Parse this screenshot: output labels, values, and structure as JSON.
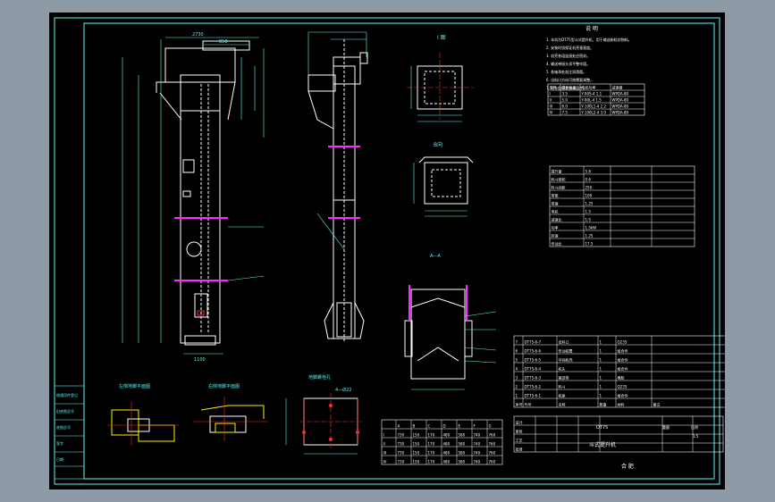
{
  "colors": {
    "background": "#000000",
    "frame": "#5FF3F3",
    "geometry": "#FFFFFF",
    "dimension": "#5FF3F3",
    "accent_magenta": "#FF2BFF",
    "accent_red": "#FF2A2A",
    "accent_yellow": "#FFF200",
    "outer_grey": "#8E9AA6"
  },
  "labels": {
    "view_top": "I 图",
    "view_side": "B向",
    "section": "A—A",
    "hole_label": "4—Ø22",
    "base_label": "地脚螺栓孔",
    "left_plan": "左侧地脚平面图",
    "right_plan": "右侧地脚平面图",
    "notes_heading": "说 明",
    "ratio_label": "1:5",
    "dims": {
      "d2730": "2730",
      "d850": "850",
      "d580": "580",
      "d1100": "1100",
      "d500": "500",
      "d400": "400",
      "d200": "200",
      "d600": "600"
    }
  },
  "bom_rows": [
    {
      "no": "7",
      "code": "DT75-6-7",
      "name": "出料口",
      "qty": "1",
      "mat": "Q235"
    },
    {
      "no": "6",
      "code": "DT75-6-6",
      "name": "传动装置",
      "qty": "1",
      "mat": "组合件"
    },
    {
      "no": "5",
      "code": "DT75-6-5",
      "name": "中间机壳",
      "qty": "1",
      "mat": "组合件"
    },
    {
      "no": "4",
      "code": "DT75-6-4",
      "name": "机头",
      "qty": "1",
      "mat": "组合件"
    },
    {
      "no": "3",
      "code": "DT75-6-3",
      "name": "输送带",
      "qty": "1",
      "mat": "橡胶"
    },
    {
      "no": "2",
      "code": "DT75-6-2",
      "name": "料斗",
      "qty": "1",
      "mat": "Q235"
    },
    {
      "no": "1",
      "code": "DT75-6-1",
      "name": "机座",
      "qty": "1",
      "mat": "组合件"
    }
  ],
  "bom_header": [
    "序号",
    "代号",
    "名称",
    "数量",
    "材料",
    "备注"
  ],
  "title_block": {
    "title": "斗式提升机",
    "drawing_no": "DT75",
    "weight_label": "重量",
    "ratio_label": "比例",
    "ratio_value": "1:5",
    "company": "合 肥",
    "rows": [
      "设计",
      "审核",
      "工艺",
      "批准"
    ]
  },
  "revision_block": {
    "rows": [
      "借通用件登记",
      "旧底图总号",
      "底图总号",
      "签字",
      "日期"
    ]
  },
  "dim_table": {
    "header": [
      "",
      "A",
      "B",
      "C",
      "D",
      "E",
      "F",
      "G"
    ],
    "rows": [
      [
        "I",
        "730",
        "150",
        "170",
        "480",
        "580",
        "740",
        "760"
      ],
      [
        "II",
        "730",
        "150",
        "170",
        "480",
        "580",
        "740",
        "760"
      ],
      [
        "III",
        "730",
        "150",
        "170",
        "480",
        "580",
        "740",
        "760"
      ],
      [
        "IV",
        "730",
        "150",
        "170",
        "480",
        "580",
        "740",
        "760"
      ]
    ]
  },
  "spec_table": {
    "header": [
      "型号",
      "提升高度",
      "电机功率",
      "减速器"
    ],
    "rows": [
      [
        "I",
        "3.5",
        "Y-90S-4 1.1",
        "WPDA-80"
      ],
      [
        "II",
        "5.0",
        "Y-90L-4 1.5",
        "WPDA-80"
      ],
      [
        "III",
        "6.0",
        "Y-100L1-4 2.2",
        "WPDA-80"
      ],
      [
        "IV",
        "7.5",
        "Y-100L2-4 3.0",
        "WPDA-80"
      ]
    ]
  },
  "param_table": {
    "rows": [
      [
        "提升量",
        "5.8"
      ],
      [
        "料斗容积",
        "0.6"
      ],
      [
        "料斗间距",
        "250"
      ],
      [
        "带宽",
        "100"
      ],
      [
        "带速",
        "1.25"
      ],
      [
        "电机",
        "1.5"
      ],
      [
        "减速比",
        "1:5"
      ],
      [
        "功率",
        "1.5kW"
      ],
      [
        "转速",
        "1.25"
      ],
      [
        "传动比",
        "17.5"
      ]
    ]
  },
  "notes": [
    "1. 本机为DT75型斗式提升机，用于输送粉粒状物料。",
    "2. 安装时须保证机壳垂直度。",
    "3. 机壳各段连接处应密封。",
    "4. 输送带接头须平整牢固。",
    "5. 各轴承处加注润滑脂。",
    "6. 出料口方向可按需要调整。",
    "7. 试车前检查各紧固件。"
  ]
}
